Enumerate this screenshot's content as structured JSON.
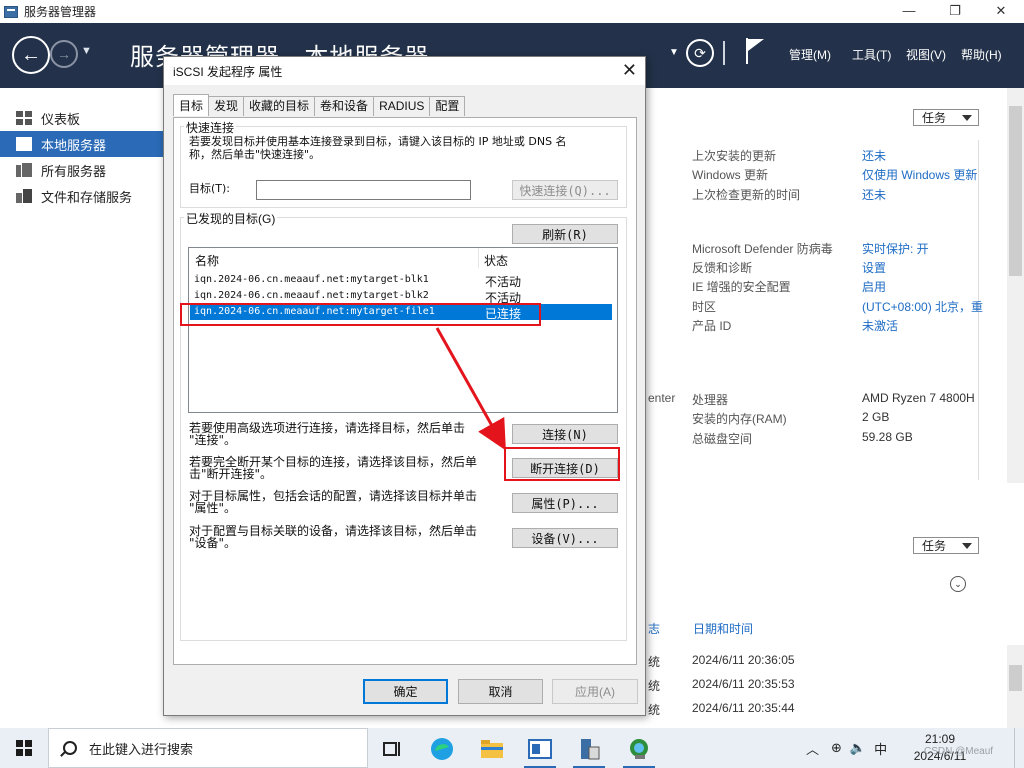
{
  "window": {
    "title": "服务器管理器",
    "minimize": "—",
    "restore": "❐",
    "close": "✕"
  },
  "header": {
    "breadcrumb": "服务器管理器 · 本地服务器",
    "menus": [
      "管理(M)",
      "工具(T)",
      "视图(V)",
      "帮助(H)"
    ]
  },
  "nav": {
    "items": [
      {
        "label": "仪表板",
        "icon": "dashboard-icon"
      },
      {
        "label": "本地服务器",
        "icon": "local-server-icon",
        "active": true
      },
      {
        "label": "所有服务器",
        "icon": "all-servers-icon"
      },
      {
        "label": "文件和存储服务",
        "icon": "file-storage-icon"
      }
    ]
  },
  "main": {
    "tasks_label": "任务",
    "properties": [
      {
        "label": "上次安装的更新",
        "value": "还未"
      },
      {
        "label": "Windows 更新",
        "value": "仅使用 Windows 更新"
      },
      {
        "label": "上次检查更新的时间",
        "value": "还未"
      },
      {
        "label": "Microsoft Defender 防病毒",
        "value": "实时保护: 开"
      },
      {
        "label": "反馈和诊断",
        "value": "设置"
      },
      {
        "label": "IE 增强的安全配置",
        "value": "启用"
      },
      {
        "label": "时区",
        "value": "(UTC+08:00) 北京，重"
      },
      {
        "label": "产品 ID",
        "value": "未激活"
      },
      {
        "label": "处理器",
        "value": "AMD Ryzen 7 4800H"
      },
      {
        "label": "安装的内存(RAM)",
        "value": "2 GB"
      },
      {
        "label": "总磁盘空间",
        "value": "59.28 GB"
      }
    ],
    "left_fragment": "enter",
    "events": {
      "col_fragment": "志",
      "col_date": "日期和时间",
      "row_fragment": "统",
      "dates": [
        "2024/6/11 20:36:05",
        "2024/6/11 20:35:53",
        "2024/6/11 20:35:44"
      ]
    }
  },
  "dialog": {
    "title": "iSCSI 发起程序 属性",
    "tabs": [
      "目标",
      "发现",
      "收藏的目标",
      "卷和设备",
      "RADIUS",
      "配置"
    ],
    "quick": {
      "group_label": "快速连接",
      "description_line1": "若要发现目标并使用基本连接登录到目标，请键入该目标的 IP 地址或 DNS 名",
      "description_line2": "称，然后单击\"快速连接\"。",
      "target_label": "目标(T):",
      "target_value": "",
      "quick_button": "快速连接(Q)..."
    },
    "discovered": {
      "group_label": "已发现的目标(G)",
      "refresh_button": "刷新(R)",
      "col_name": "名称",
      "col_status": "状态",
      "rows": [
        {
          "name": "iqn.2024-06.cn.meaauf.net:mytarget-blk1",
          "status": "不活动"
        },
        {
          "name": "iqn.2024-06.cn.meaauf.net:mytarget-blk2",
          "status": "不活动"
        },
        {
          "name": "iqn.2024-06.cn.meaauf.net:mytarget-file1",
          "status": "已连接",
          "selected": true
        }
      ]
    },
    "actions": [
      {
        "text1": "若要使用高级选项进行连接，请选择目标，然后单击",
        "text2": "\"连接\"。",
        "button": "连接(N)"
      },
      {
        "text1": "若要完全断开某个目标的连接，请选择该目标，然后单",
        "text2": "击\"断开连接\"。",
        "button": "断开连接(D)"
      },
      {
        "text1": "对于目标属性，包括会话的配置，请选择该目标并单击",
        "text2": "\"属性\"。",
        "button": "属性(P)..."
      },
      {
        "text1": "对于配置与目标关联的设备，请选择该目标，然后单击",
        "text2": "\"设备\"。",
        "button": "设备(V)..."
      }
    ],
    "ok": "确定",
    "cancel": "取消",
    "apply": "应用(A)"
  },
  "taskbar": {
    "search_placeholder": "在此键入进行搜索",
    "tray_ime": "中",
    "time": "21:09",
    "date": "2024/6/11"
  },
  "watermark": "CSDN @Meauf",
  "colors": {
    "header_bg": "#23324a",
    "nav_active": "#2a6ab6",
    "selection": "#0078d7",
    "annotation_red": "#e3141b",
    "link_blue": "#1f6cc4"
  }
}
